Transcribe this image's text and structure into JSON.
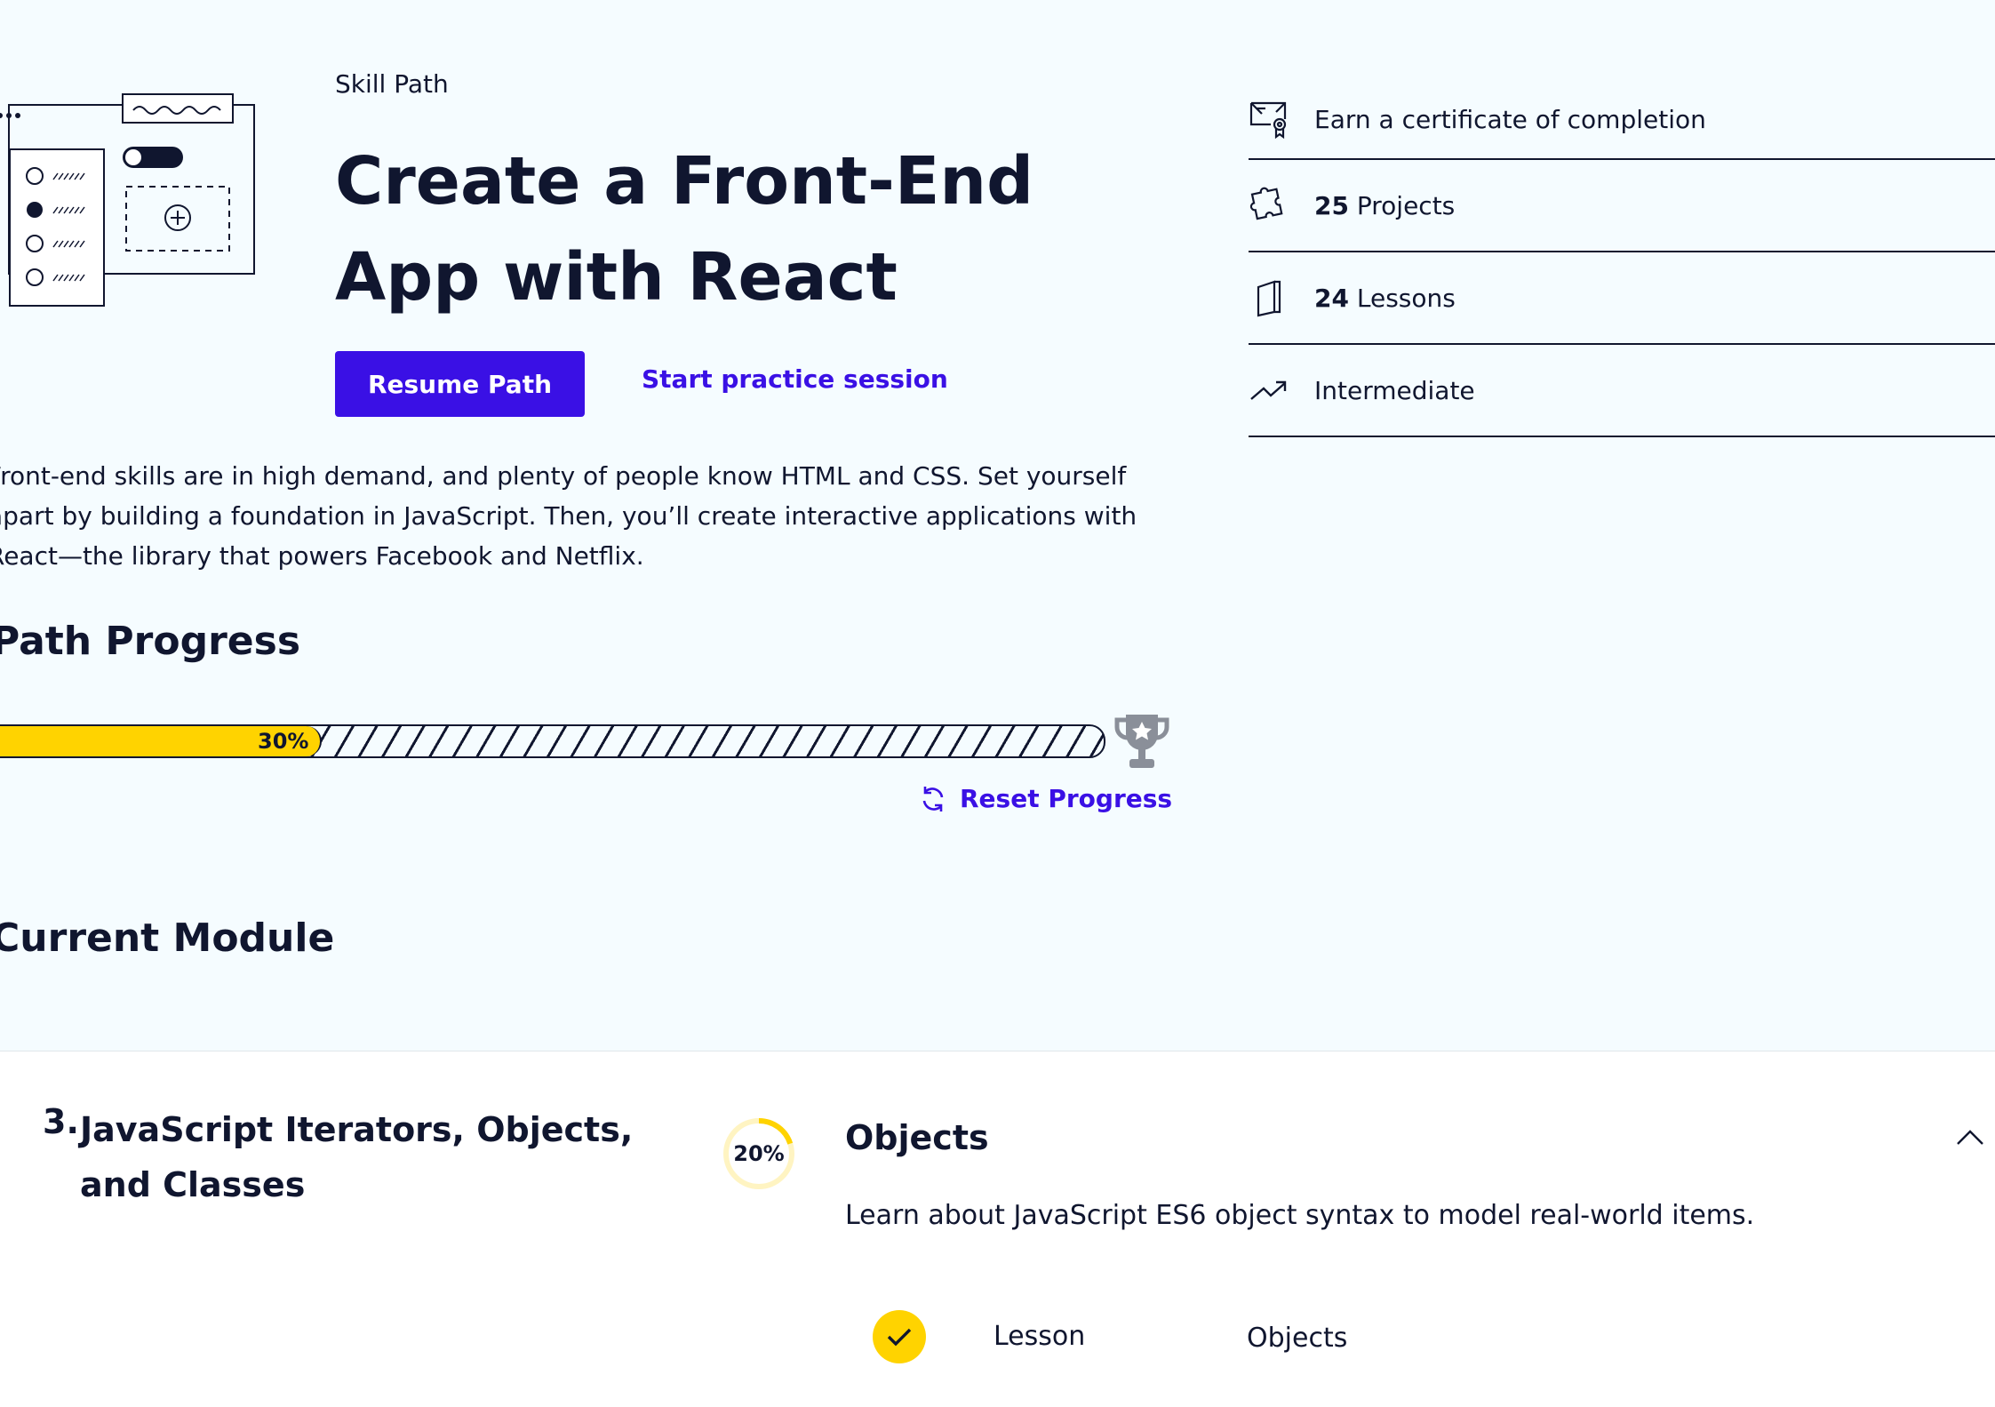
{
  "header": {
    "eyebrow": "Skill Path",
    "title": "Create a Front-End App with React",
    "primary_button": "Resume Path",
    "secondary_link": "Start practice session",
    "description": "Front-end skills are in high demand, and plenty of people know HTML and CSS. Set yourself apart by building a foundation in JavaScript. Then, you’ll create interactive applications with React—the library that powers Facebook and Netflix."
  },
  "info": {
    "certificate": "Earn a certificate of completion",
    "projects_count": "25",
    "projects_label": "Projects",
    "lessons_count": "24",
    "lessons_label": "Lessons",
    "level": "Intermediate"
  },
  "progress": {
    "heading": "Path Progress",
    "percent": 30,
    "percent_label": "30%",
    "reset_label": "Reset Progress"
  },
  "current_module": {
    "heading": "Current Module",
    "number": "3.",
    "title": "JavaScript Iterators, Objects, and Classes",
    "percent": 20,
    "percent_label": "20%",
    "subsection_title": "Objects",
    "subsection_description": "Learn about JavaScript ES6 object syntax to model real-world items.",
    "lesson_type": "Lesson",
    "lesson_name": "Objects"
  },
  "colors": {
    "background": "#f5fcff",
    "text": "#10162f",
    "accent": "#3a10e5",
    "progress": "#ffd300"
  },
  "icons": {
    "certificate": "certificate-icon",
    "projects": "puzzle-icon",
    "lessons": "book-icon",
    "level": "trend-up-icon",
    "trophy": "trophy-icon",
    "reset": "refresh-icon",
    "collapse": "chevron-up-icon",
    "check": "check-icon"
  }
}
